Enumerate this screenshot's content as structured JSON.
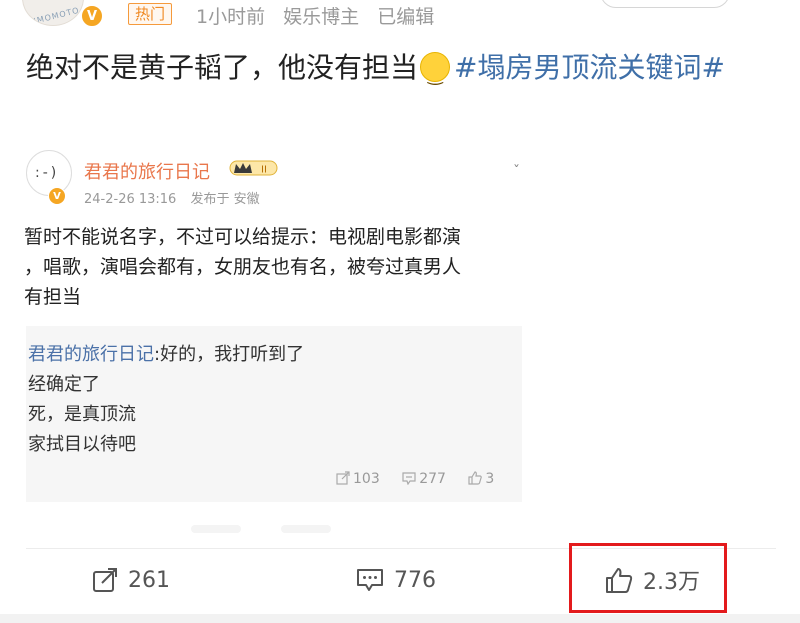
{
  "header": {
    "avatar_text": "KIMOMOTO",
    "verified_badge": "V",
    "hot_tag": "热门",
    "time": "1小时前",
    "author_type": "娱乐博主",
    "edited": "已编辑"
  },
  "post": {
    "text_main": "绝对不是黄子韬了，他没有担当",
    "emoji_icon": "smile-emoji",
    "hashtag": "#塌房男顶流关键词#"
  },
  "embed": {
    "verified_badge": "V",
    "name": "君君的旅行日记",
    "level_badge_text": "II",
    "date": "24-2-26 13:16",
    "location": "发布于 安徽",
    "body_lines": [
      "暂时不能说名字，不过可以给提示：电视剧电影都演",
      "，唱歌，演唱会都有，女朋友也有名，被夸过真男人",
      "有担当"
    ],
    "comment": {
      "name": "君君的旅行日记",
      "first_text": ":好的，我打听到了",
      "lines": [
        "经确定了",
        "死，是真顶流",
        "家拭目以待吧"
      ]
    },
    "actions": {
      "repost": "103",
      "comment": "277",
      "like": "3"
    }
  },
  "actions": {
    "repost_count": "261",
    "comment_count": "776",
    "like_count": "2.3万"
  },
  "colors": {
    "hashtag": "#3f6fa8",
    "embed_name": "#e9774c",
    "hot_tag": "#f08a24",
    "highlight": "#e31a1c"
  }
}
